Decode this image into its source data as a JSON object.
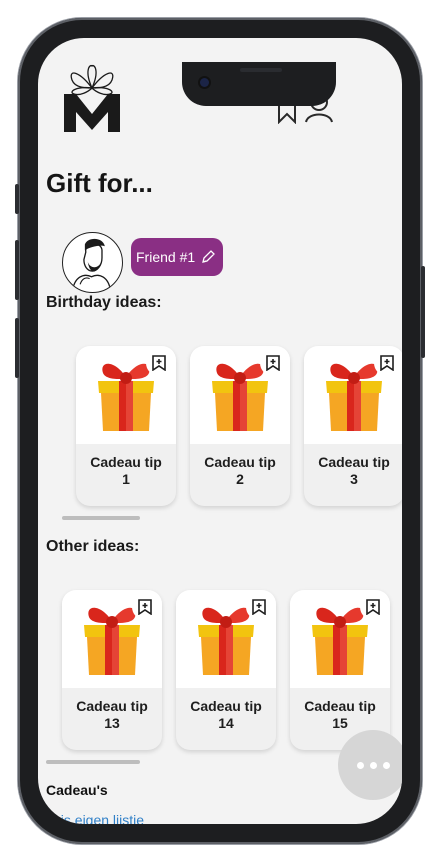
{
  "header": {
    "brand_logo": "gift-bow-M-logo",
    "icons": [
      "bookmark-icon",
      "user-icon"
    ]
  },
  "page_title": "Gift for...",
  "friend": {
    "avatar": "bearded-man-avatar",
    "chip_label": "Friend #1",
    "chip_color": "#8a2f84",
    "edit_icon": "pencil-icon"
  },
  "birthday_section": {
    "title": "Birthday ideas:",
    "cards": [
      {
        "line1": "Cadeau tip",
        "line2": "1"
      },
      {
        "line1": "Cadeau tip",
        "line2": "2"
      },
      {
        "line1": "Cadeau tip",
        "line2": "3"
      }
    ]
  },
  "other_section": {
    "title": "Other ideas:",
    "cards": [
      {
        "line1": "Cadeau tip",
        "line2": "13"
      },
      {
        "line1": "Cadeau tip",
        "line2": "14"
      },
      {
        "line1": "Cadeau tip",
        "line2": "15"
      }
    ]
  },
  "footer": {
    "section_title": "Cadeau's",
    "link_text": "Ik is eigen lijstje"
  },
  "fab": {
    "icon": "more-dots-icon"
  },
  "colors": {
    "accent": "#8a2f84",
    "link": "#2f7fc7",
    "background": "#f3f3f3"
  }
}
